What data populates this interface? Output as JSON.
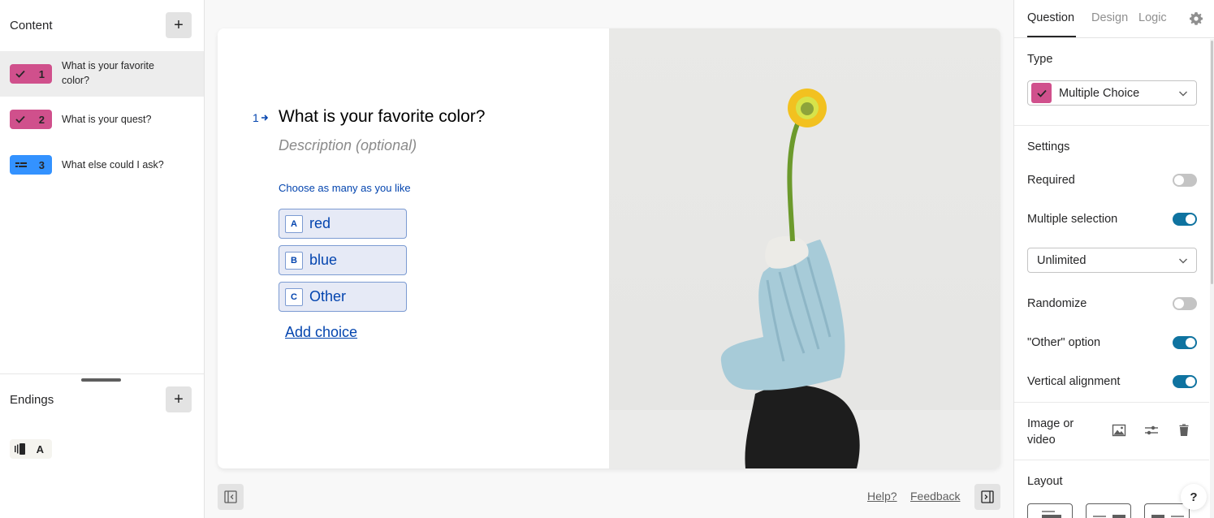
{
  "sidebar": {
    "content_title": "Content",
    "add_label": "+",
    "questions": [
      {
        "number": "1",
        "label": "What is your favorite color?",
        "type_icon": "check-icon",
        "color": "#d0508c",
        "active": true
      },
      {
        "number": "2",
        "label": "What is your quest?",
        "type_icon": "check-icon",
        "color": "#d0508c",
        "active": false
      },
      {
        "number": "3",
        "label": "What else could I ask?",
        "type_icon": "short-text-icon",
        "color": "#3392ff",
        "active": false
      }
    ],
    "endings_title": "Endings",
    "endings": [
      {
        "letter": "A",
        "icon": "ending-screen-icon"
      }
    ]
  },
  "canvas": {
    "question_number": "1",
    "question_title": "What is your favorite color?",
    "description_placeholder": "Description (optional)",
    "hint": "Choose as many as you like",
    "choices": [
      {
        "key": "A",
        "label": "red"
      },
      {
        "key": "B",
        "label": "blue"
      },
      {
        "key": "C",
        "label": "Other"
      }
    ],
    "add_choice": "Add choice",
    "image_alt": "Yellow flower in a blue and black clay sculpture",
    "footer": {
      "help": "Help?",
      "feedback": "Feedback"
    }
  },
  "panel": {
    "tabs": [
      {
        "label": "Question",
        "active": true
      },
      {
        "label": "Design",
        "active": false
      },
      {
        "label": "Logic",
        "active": false
      }
    ],
    "type_label": "Type",
    "type_value": "Multiple Choice",
    "settings_label": "Settings",
    "settings": [
      {
        "label": "Required",
        "on": false
      },
      {
        "label": "Multiple selection",
        "on": true
      }
    ],
    "multiple_limit": "Unlimited",
    "settings2": [
      {
        "label": "Randomize",
        "on": false
      },
      {
        "label": "\"Other\" option",
        "on": true
      },
      {
        "label": "Vertical alignment",
        "on": true
      }
    ],
    "media_label": "Image or video",
    "layout_label": "Layout",
    "help_fab": "?"
  },
  "colors": {
    "multiple_choice": "#d0508c",
    "short_text": "#3392ff",
    "accent_blue": "#0445af",
    "toggle_on": "#0f73a0"
  }
}
